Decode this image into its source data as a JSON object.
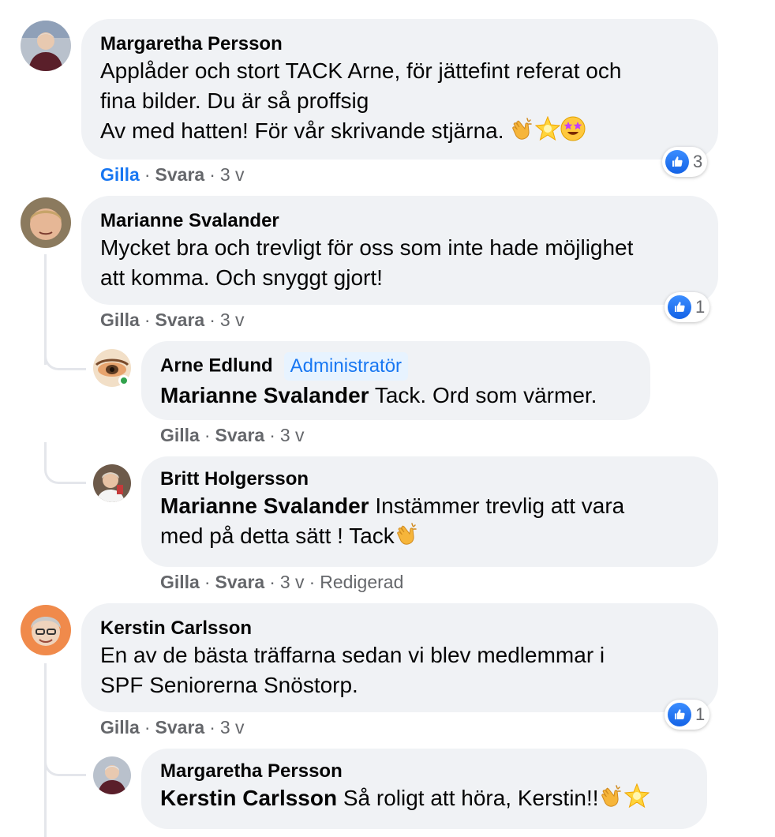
{
  "comments": [
    {
      "author": "Margaretha Persson",
      "lines": [
        "Applåder och stort TACK Arne, för jättefint referat och",
        "fina bilder. Du är så proffsig",
        "Av med hatten! För vår skrivande stjärna."
      ],
      "emojis": [
        "clapping-hands",
        "glowing-star",
        "star-struck-face"
      ],
      "actions": {
        "like": "Gilla",
        "reply": "Svara",
        "time": "3 v"
      },
      "reaction_count": "3",
      "liked": true
    },
    {
      "author": "Marianne Svalander",
      "lines": [
        "Mycket bra och trevligt för oss som inte hade möjlighet",
        "att komma. Och snyggt gjort!"
      ],
      "actions": {
        "like": "Gilla",
        "reply": "Svara",
        "time": "3 v"
      },
      "reaction_count": "1",
      "replies": [
        {
          "author": "Arne Edlund",
          "badge": "Administratör",
          "mention": "Marianne Svalander",
          "text": " Tack. Ord som värmer.",
          "actions": {
            "like": "Gilla",
            "reply": "Svara",
            "time": "3 v"
          }
        },
        {
          "author": "Britt Holgersson",
          "mention": "Marianne Svalander",
          "line1": " Instämmer trevlig att vara",
          "line2": "med på detta sätt ! Tack",
          "emojis": [
            "clapping-hands"
          ],
          "actions": {
            "like": "Gilla",
            "reply": "Svara",
            "time": "3 v",
            "edited": "Redigerad"
          }
        }
      ]
    },
    {
      "author": "Kerstin Carlsson",
      "lines": [
        "En av de bästa träffarna sedan vi blev medlemmar i",
        "SPF Seniorerna Snöstorp."
      ],
      "actions": {
        "like": "Gilla",
        "reply": "Svara",
        "time": "3 v"
      },
      "reaction_count": "1",
      "replies": [
        {
          "author": "Margaretha Persson",
          "mention": "Kerstin Carlsson",
          "text": " Så roligt att höra, Kerstin!!",
          "emojis": [
            "clapping-hands",
            "glowing-star"
          ]
        }
      ]
    }
  ],
  "colors": {
    "bubble": "#f0f2f5",
    "like_blue": "#1877f2",
    "meta_gray": "#65676b",
    "online_green": "#31a24c"
  }
}
